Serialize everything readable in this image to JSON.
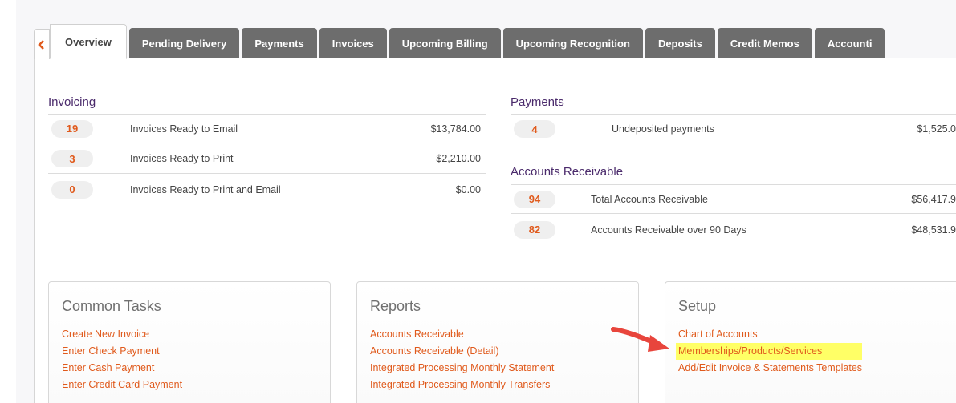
{
  "tabs": [
    {
      "label": "Overview",
      "active": true
    },
    {
      "label": "Pending Delivery"
    },
    {
      "label": "Payments"
    },
    {
      "label": "Invoices"
    },
    {
      "label": "Upcoming Billing"
    },
    {
      "label": "Upcoming Recognition"
    },
    {
      "label": "Deposits"
    },
    {
      "label": "Credit Memos"
    },
    {
      "label": "Accounti"
    }
  ],
  "invoicing": {
    "title": "Invoicing",
    "rows": [
      {
        "count": "19",
        "label": "Invoices Ready to Email",
        "amount": "$13,784.00"
      },
      {
        "count": "3",
        "label": "Invoices Ready to Print",
        "amount": "$2,210.00"
      },
      {
        "count": "0",
        "label": "Invoices Ready to Print and Email",
        "amount": "$0.00"
      }
    ]
  },
  "payments": {
    "title": "Payments",
    "rows": [
      {
        "count": "4",
        "label": "Undeposited payments",
        "amount": "$1,525.0"
      }
    ]
  },
  "receivable": {
    "title": "Accounts Receivable",
    "rows": [
      {
        "count": "94",
        "label": "Total Accounts Receivable",
        "amount": "$56,417.9"
      },
      {
        "count": "82",
        "label": "Accounts Receivable over 90 Days",
        "amount": "$48,531.9"
      }
    ]
  },
  "common_tasks": {
    "title": "Common Tasks",
    "links": [
      "Create New Invoice",
      "Enter Check Payment",
      "Enter Cash Payment",
      "Enter Credit Card Payment"
    ]
  },
  "reports": {
    "title": "Reports",
    "links": [
      "Accounts Receivable",
      "Accounts Receivable (Detail)",
      "Integrated Processing Monthly Statement",
      "Integrated Processing Monthly Transfers"
    ]
  },
  "setup": {
    "title": "Setup",
    "links": [
      "Chart of Accounts",
      "Memberships/Products/Services",
      "Add/Edit Invoice & Statements Templates"
    ]
  },
  "colors": {
    "accent": "#e05a1c",
    "heading": "#4a2a6b",
    "tab_bg": "#6d6d6d",
    "highlight": "#ffff66",
    "arrow": "#e8453c"
  }
}
